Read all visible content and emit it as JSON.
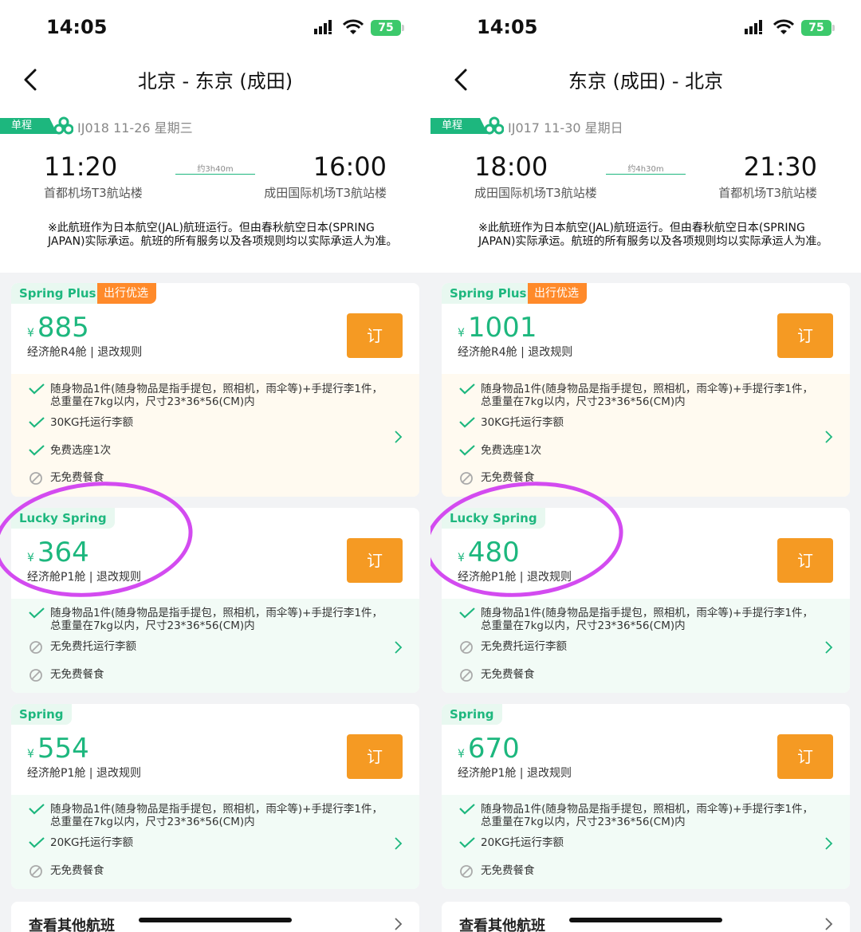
{
  "screens": [
    {
      "status": {
        "time": "14:05",
        "battery": "75"
      },
      "nav": {
        "title": "北京 - 东京 (成田)"
      },
      "flight": {
        "trip_tag": "单程",
        "flight_no": "IJ018 11-26 星期三",
        "dep_time": "11:20",
        "arr_time": "16:00",
        "duration": "约3h40m",
        "dep_airport": "首都机场T3航站楼",
        "arr_airport": "成田国际机场T3航站楼",
        "notice": "※此航班作为日本航空(JAL)航班运行。但由春秋航空日本(SPRING JAPAN)实际承运。航班的所有服务以及各项规则均以实际承运人为准。"
      },
      "products": [
        {
          "name": "Spring Plus",
          "badge": "出行优选",
          "currency": "¥",
          "price": "885",
          "cabin": "经济舱R4舱 | 退改规则",
          "book": "订",
          "features": [
            {
              "ok": true,
              "text": "随身物品1件(随身物品是指手提包，照相机，雨伞等)+手提行李1件，总重量在7kg以内，尺寸23*36*56(CM)内"
            },
            {
              "ok": true,
              "text": "30KG托运行李额"
            },
            {
              "ok": true,
              "text": "免费选座1次"
            },
            {
              "ok": false,
              "text": "无免费餐食"
            }
          ]
        },
        {
          "name": "Lucky Spring",
          "badge": "",
          "currency": "¥",
          "price": "364",
          "cabin": "经济舱P1舱 | 退改规则",
          "book": "订",
          "features": [
            {
              "ok": true,
              "text": "随身物品1件(随身物品是指手提包，照相机，雨伞等)+手提行李1件，总重量在7kg以内，尺寸23*36*56(CM)内"
            },
            {
              "ok": false,
              "text": "无免费托运行李额"
            },
            {
              "ok": false,
              "text": "无免费餐食"
            }
          ]
        },
        {
          "name": "Spring",
          "badge": "",
          "currency": "¥",
          "price": "554",
          "cabin": "经济舱P1舱 | 退改规则",
          "book": "订",
          "features": [
            {
              "ok": true,
              "text": "随身物品1件(随身物品是指手提包，照相机，雨伞等)+手提行李1件，总重量在7kg以内，尺寸23*36*56(CM)内"
            },
            {
              "ok": true,
              "text": "20KG托运行李额"
            },
            {
              "ok": false,
              "text": "无免费餐食"
            }
          ]
        }
      ],
      "other_flights": "查看其他航班"
    },
    {
      "status": {
        "time": "14:05",
        "battery": "75"
      },
      "nav": {
        "title": "东京 (成田) - 北京"
      },
      "flight": {
        "trip_tag": "单程",
        "flight_no": "IJ017 11-30 星期日",
        "dep_time": "18:00",
        "arr_time": "21:30",
        "duration": "约4h30m",
        "dep_airport": "成田国际机场T3航站楼",
        "arr_airport": "首都机场T3航站楼",
        "notice": "※此航班作为日本航空(JAL)航班运行。但由春秋航空日本(SPRING JAPAN)实际承运。航班的所有服务以及各项规则均以实际承运人为准。"
      },
      "products": [
        {
          "name": "Spring Plus",
          "badge": "出行优选",
          "currency": "¥",
          "price": "1001",
          "cabin": "经济舱R4舱 | 退改规则",
          "book": "订",
          "features": [
            {
              "ok": true,
              "text": "随身物品1件(随身物品是指手提包，照相机，雨伞等)+手提行李1件，总重量在7kg以内，尺寸23*36*56(CM)内"
            },
            {
              "ok": true,
              "text": "30KG托运行李额"
            },
            {
              "ok": true,
              "text": "免费选座1次"
            },
            {
              "ok": false,
              "text": "无免费餐食"
            }
          ]
        },
        {
          "name": "Lucky Spring",
          "badge": "",
          "currency": "¥",
          "price": "480",
          "cabin": "经济舱P1舱 | 退改规则",
          "book": "订",
          "features": [
            {
              "ok": true,
              "text": "随身物品1件(随身物品是指手提包，照相机，雨伞等)+手提行李1件，总重量在7kg以内，尺寸23*36*56(CM)内"
            },
            {
              "ok": false,
              "text": "无免费托运行李额"
            },
            {
              "ok": false,
              "text": "无免费餐食"
            }
          ]
        },
        {
          "name": "Spring",
          "badge": "",
          "currency": "¥",
          "price": "670",
          "cabin": "经济舱P1舱 | 退改规则",
          "book": "订",
          "features": [
            {
              "ok": true,
              "text": "随身物品1件(随身物品是指手提包，照相机，雨伞等)+手提行李1件，总重量在7kg以内，尺寸23*36*56(CM)内"
            },
            {
              "ok": true,
              "text": "20KG托运行李额"
            },
            {
              "ok": false,
              "text": "无免费餐食"
            }
          ]
        }
      ],
      "other_flights": "查看其他航班"
    }
  ]
}
